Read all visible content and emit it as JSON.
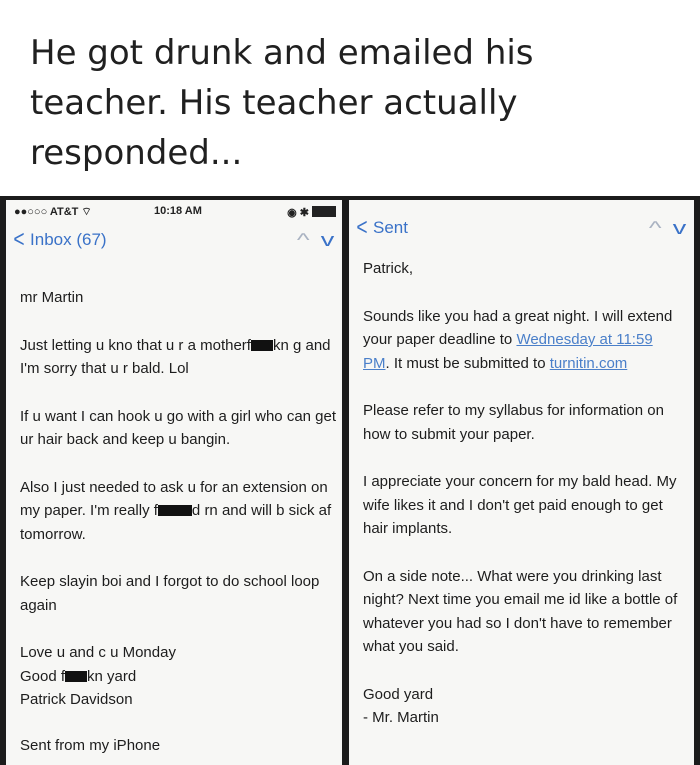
{
  "caption": "He got drunk and emailed his teacher. His teacher actually responded...",
  "left_panel": {
    "status_bar": {
      "carrier": "●●○○○ AT&T ⌔",
      "time": "10:18 AM",
      "battery": "◉ ✱"
    },
    "back_label": "Inbox (67)",
    "arrow_up": "^",
    "arrow_down": "v",
    "greeting": "mr Martin",
    "p1_a": "Just letting u kno that u r a motherf",
    "p1_b": "kn",
    "p1_c": "g and I'm sorry that u r bald. Lol",
    "p2": "If u want I can hook u go with a girl who can get ur hair back and keep u bangin.",
    "p3_a": "Also I just needed to ask u for an extension on my paper. I'm really f",
    "p3_b": "d",
    "p3_c": "rn and will b sick af tomorrow.",
    "p4": "Keep slayin boi and I forgot to do school loop again",
    "sign1": "Love u and c u Monday",
    "sign2_a": "Good f",
    "sign2_b": "kn yard",
    "sign3": "Patrick Davidson",
    "footer": "Sent from my iPhone"
  },
  "right_panel": {
    "back_label": "Sent",
    "arrow_up": "^",
    "arrow_down": "v",
    "greeting": "Patrick,",
    "p1_a": "Sounds like you had a great night. I will extend your paper deadline to ",
    "p1_link": "Wednesday at 11:59 PM",
    "p1_b": ". It must be submitted to ",
    "p1_link2": "turnitin.com",
    "p2": "Please refer to my syllabus for information on how to submit your paper.",
    "p3": "I appreciate your concern for my bald head. My wife likes it and I don't get paid enough to get hair implants.",
    "p4": "On a side note... What were you drinking last night? Next time you email me id like a bottle of whatever you had so I don't have to remember what you said.",
    "sign1": "Good yard",
    "sign2": "- Mr. Martin"
  }
}
